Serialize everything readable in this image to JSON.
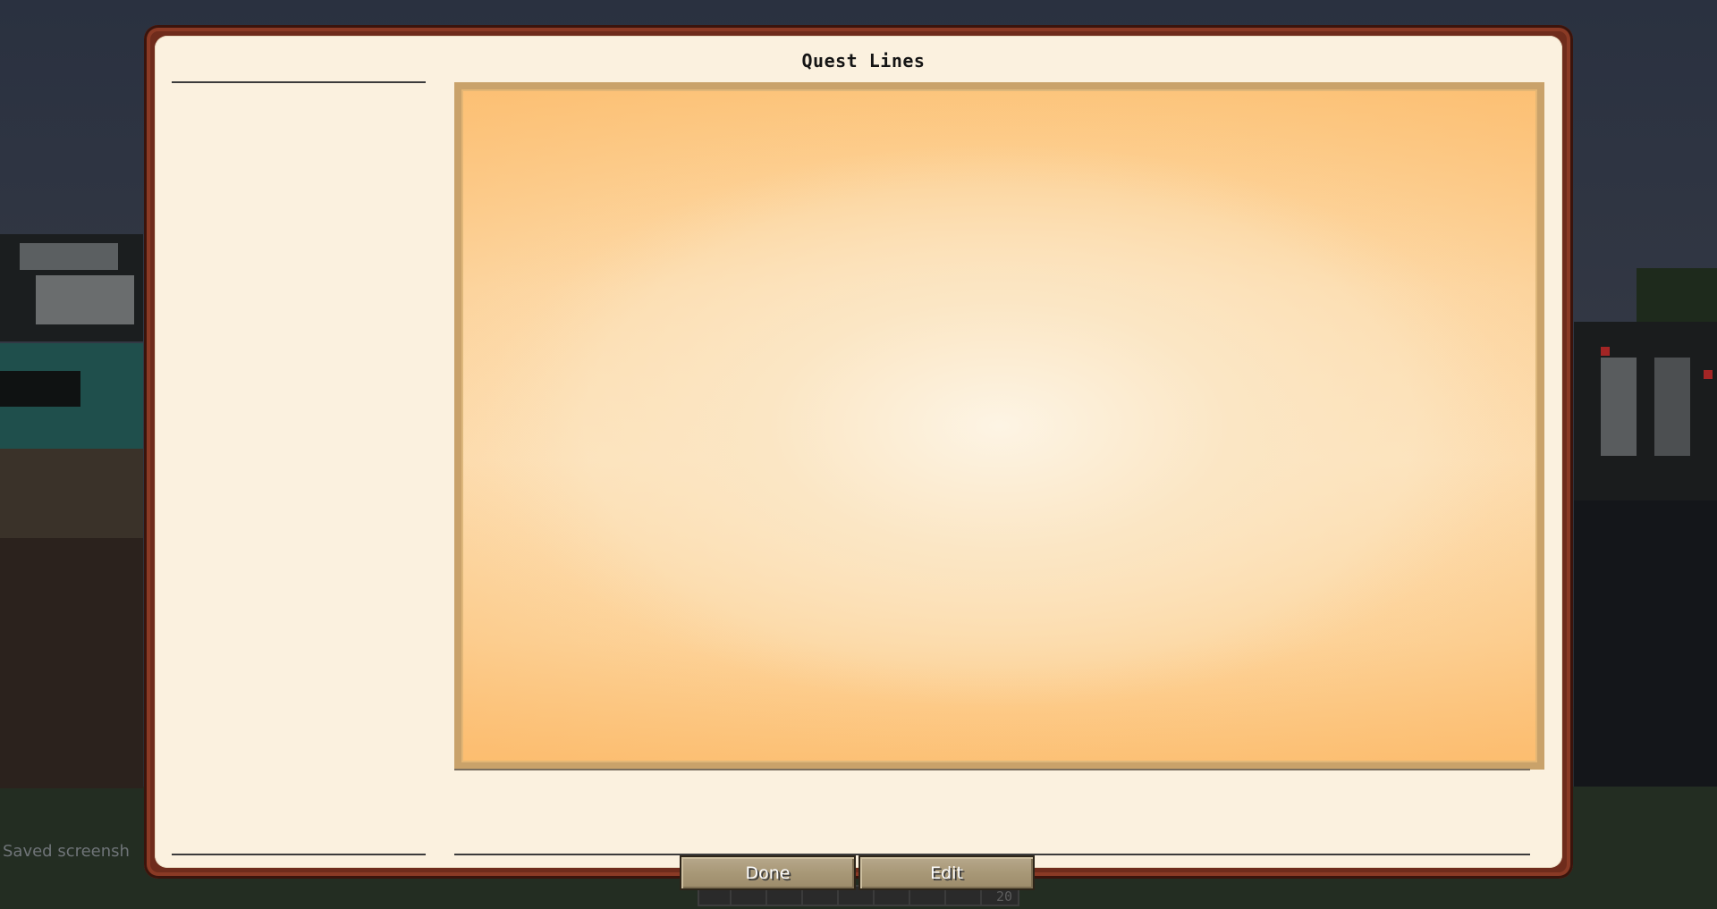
{
  "window": {
    "title": "Quest Lines"
  },
  "sidebar": {
    "quest_lines": []
  },
  "buttons": {
    "done_label": "Done",
    "edit_label": "Edit"
  },
  "background": {
    "chat_message": "Saved screensh",
    "hotbar_stack_count": "20"
  },
  "colors": {
    "frame": "#6f2c1c",
    "panel": "#fbf1df",
    "map_border": "#c9a26a",
    "button": "#a89877"
  }
}
